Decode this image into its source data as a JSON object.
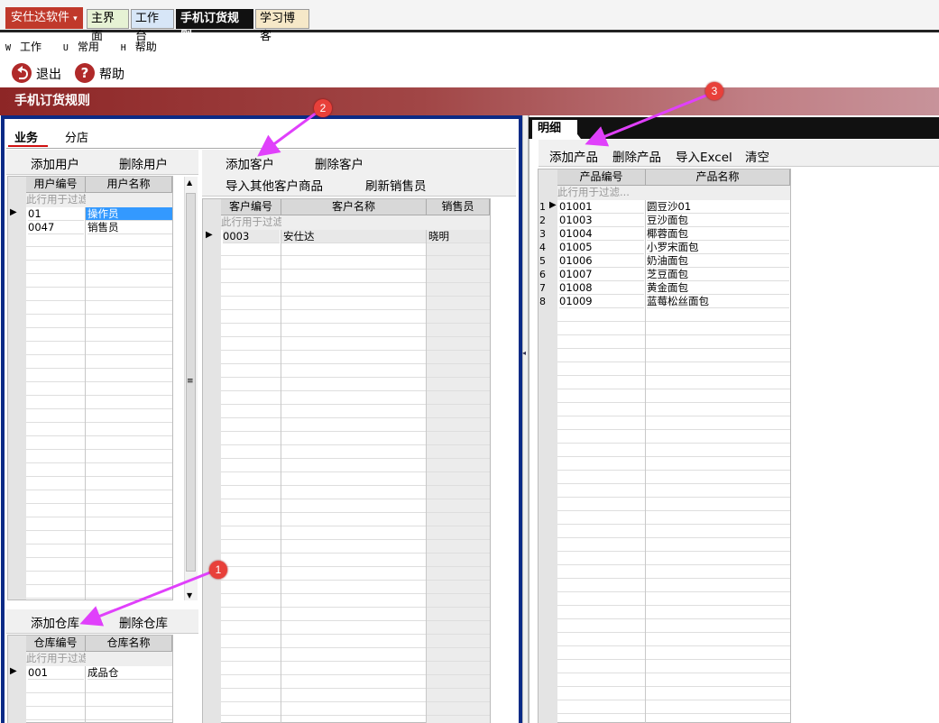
{
  "app": {
    "brand": "安仕达软件",
    "brand_arrow": "▾"
  },
  "top_tabs": [
    "主界面",
    "工作台",
    "手机订货规则",
    "学习博客"
  ],
  "menu": [
    {
      "key": "W",
      "label": "工作"
    },
    {
      "key": "U",
      "label": "常用"
    },
    {
      "key": "H",
      "label": "帮助"
    }
  ],
  "toolbar": {
    "exit_label": "退出",
    "help_label": "帮助"
  },
  "page_title": "手机订货规则",
  "sub_tabs": [
    "业务",
    "分店"
  ],
  "users_panel": {
    "add_label": "添加用户",
    "delete_label": "删除用户",
    "columns": [
      "用户编号",
      "用户名称"
    ],
    "filter_text": "此行用于过滤",
    "rows": [
      {
        "code": "01",
        "name": "操作员"
      },
      {
        "code": "0047",
        "name": "销售员"
      }
    ]
  },
  "warehouse_panel": {
    "add_label": "添加仓库",
    "delete_label": "删除仓库",
    "columns": [
      "仓库编号",
      "仓库名称"
    ],
    "filter_text": "此行用于过滤",
    "rows": [
      {
        "code": "001",
        "name": "成品仓"
      }
    ]
  },
  "customer_panel": {
    "add_label": "添加客户",
    "delete_label": "删除客户",
    "import_label": "导入其他客户商品",
    "refresh_label": "刷新销售员",
    "columns": [
      "客户编号",
      "客户名称",
      "销售员"
    ],
    "filter_text": "此行用于过滤",
    "rows": [
      {
        "code": "0003",
        "name": "安仕达",
        "sales": "晓明"
      }
    ]
  },
  "detail_panel": {
    "tab_label": "明细",
    "add_label": "添加产品",
    "delete_label": "删除产品",
    "import_label": "导入Excel",
    "clear_label": "清空",
    "columns": [
      "产品编号",
      "产品名称"
    ],
    "filter_text": "此行用于过滤...",
    "rows": [
      {
        "n": "1",
        "code": "01001",
        "name": "圆豆沙01"
      },
      {
        "n": "2",
        "code": "01003",
        "name": "豆沙面包"
      },
      {
        "n": "3",
        "code": "01004",
        "name": "椰蓉面包"
      },
      {
        "n": "4",
        "code": "01005",
        "name": "小罗宋面包"
      },
      {
        "n": "5",
        "code": "01006",
        "name": "奶油面包"
      },
      {
        "n": "6",
        "code": "01007",
        "name": "芝豆面包"
      },
      {
        "n": "7",
        "code": "01008",
        "name": "黄金面包"
      },
      {
        "n": "8",
        "code": "01009",
        "name": "蓝莓松丝面包"
      }
    ]
  },
  "annotations": [
    "1",
    "2",
    "3"
  ],
  "colors": {
    "accent": "#e040fb",
    "badge": "#e8403a",
    "banner": "#8d2626",
    "panel_border": "#0a2a86"
  }
}
